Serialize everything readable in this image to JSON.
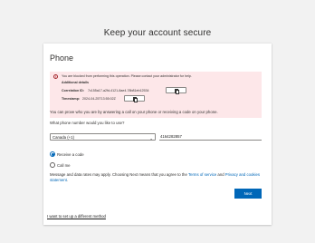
{
  "page": {
    "title": "Keep your account secure"
  },
  "card": {
    "title": "Phone",
    "error": {
      "message": "You are blocked from performing this operation. Please contact your administrator for help.",
      "details_heading": "Additional details",
      "correlation_label": "Correlation ID:",
      "correlation_value": "7c155a17-a2fd-4121-8ae4-78b81eb12534",
      "timestamp_label": "Timestamp:",
      "timestamp_value": "2024-04-25T13:55:02Z"
    },
    "intro": "You can prove who you are by answering a call on your phone or receiving a code on your phone.",
    "question": "What phone number would you like to use?",
    "country_value": "Canada (+1)",
    "phone_value": "4164282857",
    "options": [
      {
        "label": "Receive a code",
        "checked": true
      },
      {
        "label": "Call me",
        "checked": false
      }
    ],
    "terms_prefix": "Message and data rates may apply. Choosing Next means that you agree to the ",
    "terms_link": "Terms of service",
    "terms_and": " and ",
    "privacy_link": "Privacy and cookies statement",
    "terms_suffix": ".",
    "next_label": "Next",
    "alt_method": "I want to set up a different method"
  },
  "colors": {
    "accent": "#0067b8",
    "error_bg": "#fde7e9",
    "error_icon": "#a4262c"
  }
}
